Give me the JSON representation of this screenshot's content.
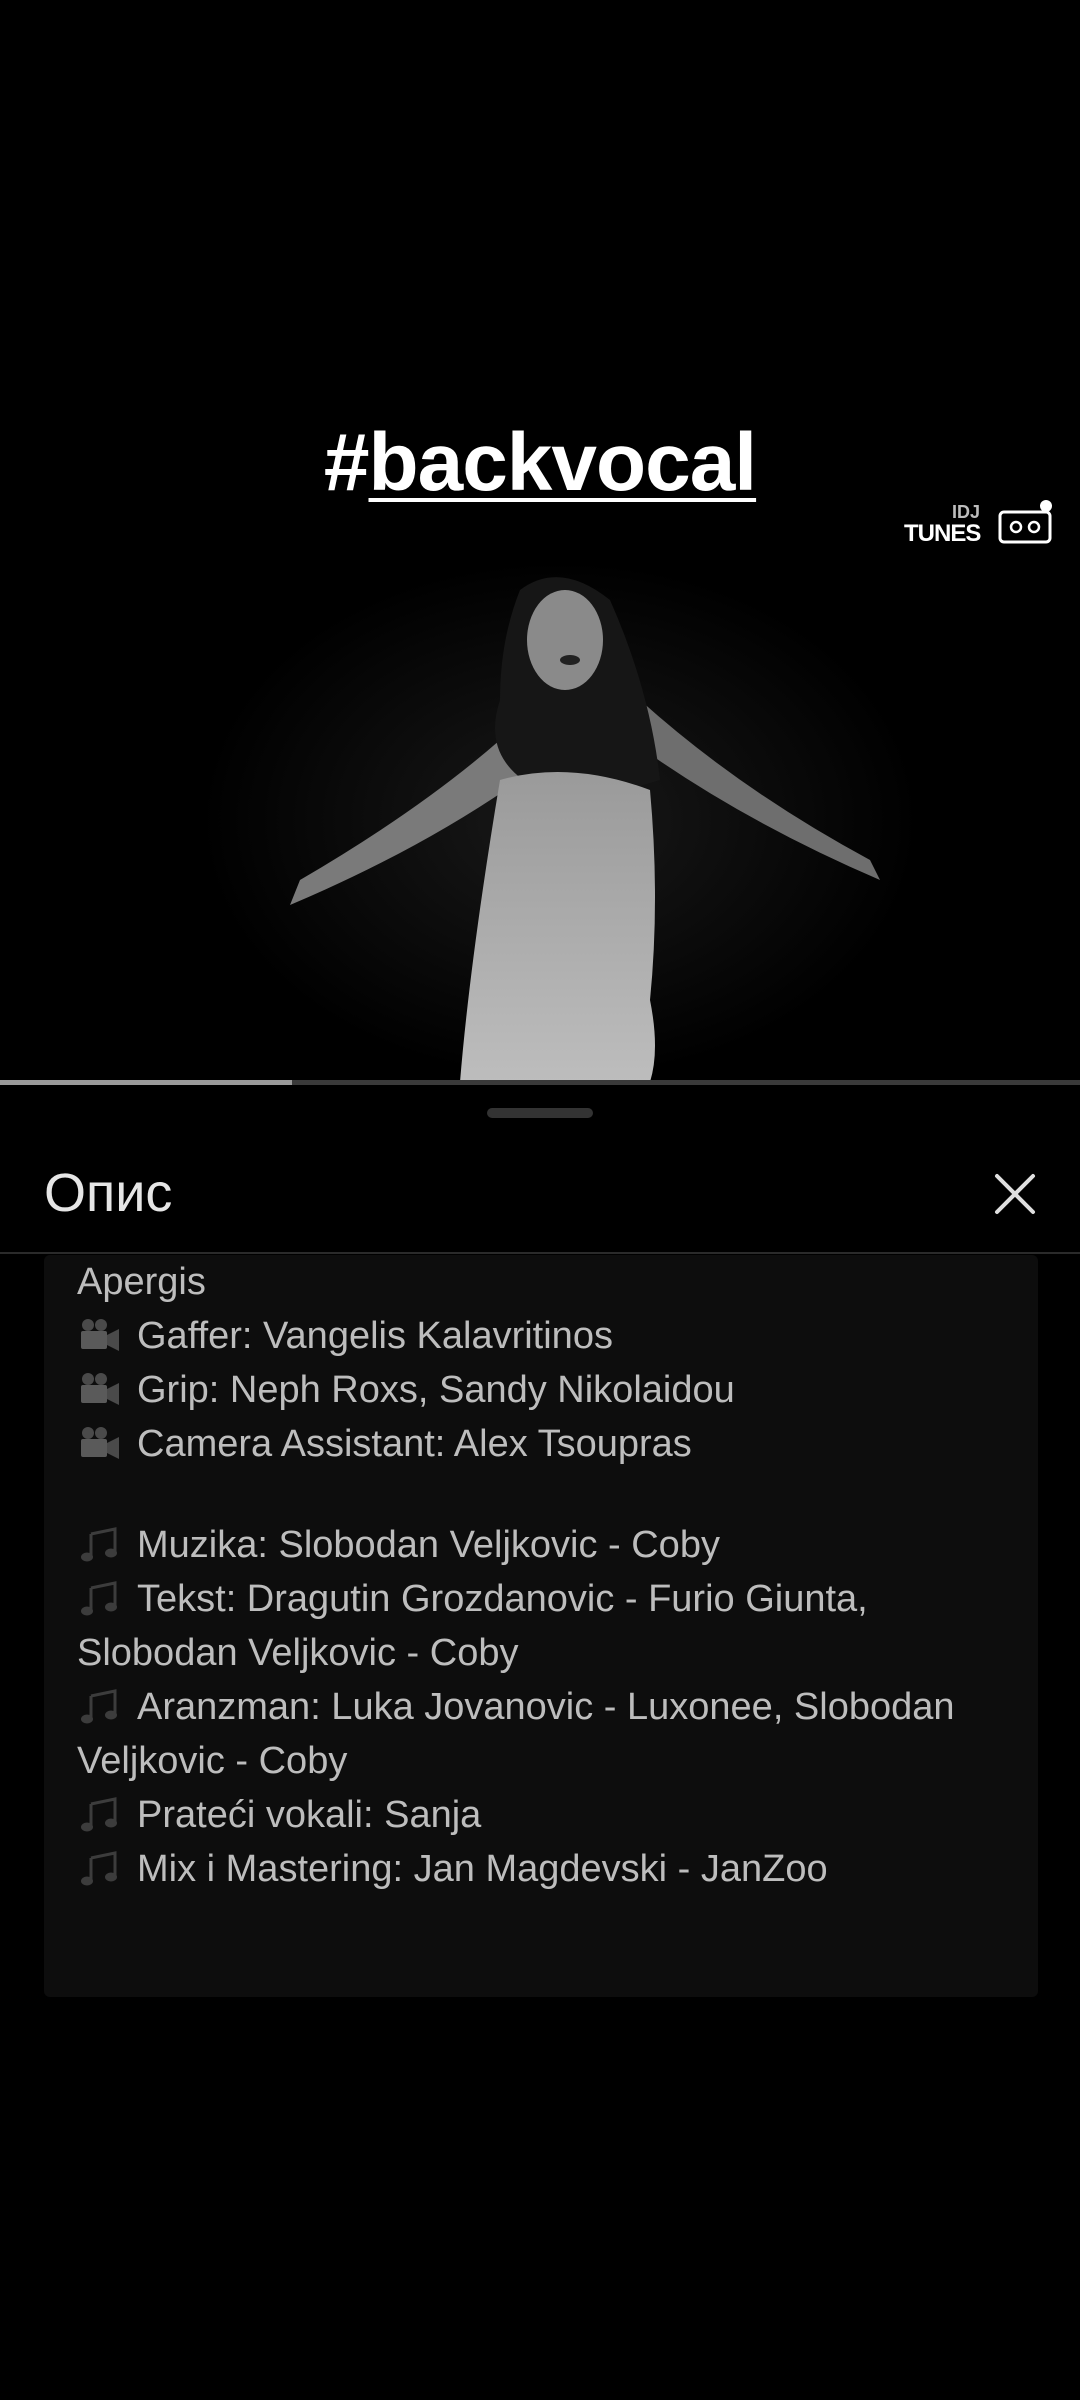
{
  "video": {
    "hashtag_symbol": "#",
    "hashtag_word": "backvocal",
    "watermark_top": "IDJ",
    "watermark_main": "TUNES",
    "progress_fraction": 0.27
  },
  "sheet": {
    "title": "Опис",
    "close_icon": "close-icon"
  },
  "description": {
    "lines": [
      {
        "icon": "",
        "text": "Apergis"
      },
      {
        "icon": "film-camera-icon",
        "text": "Gaffer: Vangelis Kalavritinos"
      },
      {
        "icon": "film-camera-icon",
        "text": "Grip: Neph Roxs, Sandy Nikolaidou"
      },
      {
        "icon": "film-camera-icon",
        "text": "Camera Assistant: Alex Tsoupras"
      },
      {
        "icon": "",
        "text": ""
      },
      {
        "icon": "music-notes-icon",
        "text": "Muzika: Slobodan Veljkovic - Coby"
      },
      {
        "icon": "music-notes-icon",
        "text": "Tekst: Dragutin Grozdanovic - Furio Giunta,"
      },
      {
        "icon": "",
        "text": "Slobodan Veljkovic - Coby"
      },
      {
        "icon": "music-notes-icon",
        "text": "Aranzman: Luka Jovanovic - Luxonee, Slobodan"
      },
      {
        "icon": "",
        "text": "Veljkovic - Coby"
      },
      {
        "icon": "music-notes-icon",
        "text": "Prateći vokali: Sanja"
      },
      {
        "icon": "music-notes-icon",
        "text": "Mix i Mastering: Jan Magdevski - JanZoo"
      }
    ]
  }
}
